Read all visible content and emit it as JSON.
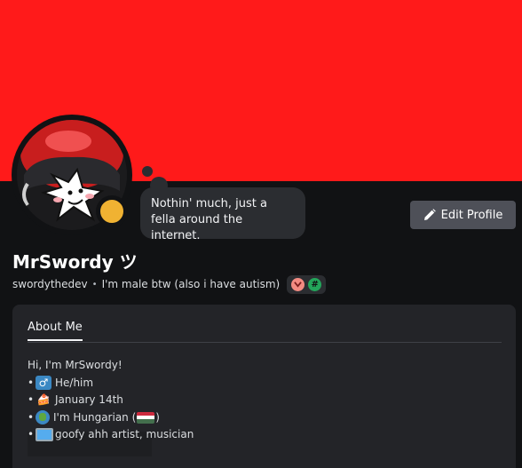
{
  "profile": {
    "display_name": "MrSwordy ツ",
    "username": "swordythedev",
    "separator": "•",
    "custom_status": "I'm male btw (also i have autism)",
    "bubble_text": "Nothin' much, just a fella around the internet.",
    "status": "idle"
  },
  "actions": {
    "edit_profile_label": "Edit Profile"
  },
  "badges": [
    {
      "icon": "heart-icon",
      "color": "#f28b82"
    },
    {
      "icon": "hashtag-icon",
      "color": "#23a55a",
      "glyph": "#"
    }
  ],
  "about": {
    "tab_label": "About Me",
    "lines": [
      {
        "text": "Hi, I'm MrSwordy!"
      },
      {
        "bullet": "•",
        "icon": "male-sign-icon",
        "glyph": "♂",
        "text": "He/him"
      },
      {
        "bullet": "•",
        "icon": "birthday-cake-icon",
        "glyph": "🍰",
        "text": "January 14th"
      },
      {
        "bullet": "•",
        "icon": "globe-icon",
        "text_before": "I'm Hungarian (",
        "text_after": ")"
      },
      {
        "bullet": "•",
        "icon": "computer-icon",
        "text": "goofy ahh artist, musician"
      }
    ]
  },
  "colors": {
    "banner": "#ff1a1a",
    "background": "#111214",
    "panel": "#232428",
    "idle_status": "#f0b232",
    "flag_red": "#cd2a3e",
    "flag_white": "#ffffff",
    "flag_green": "#436f4d"
  }
}
